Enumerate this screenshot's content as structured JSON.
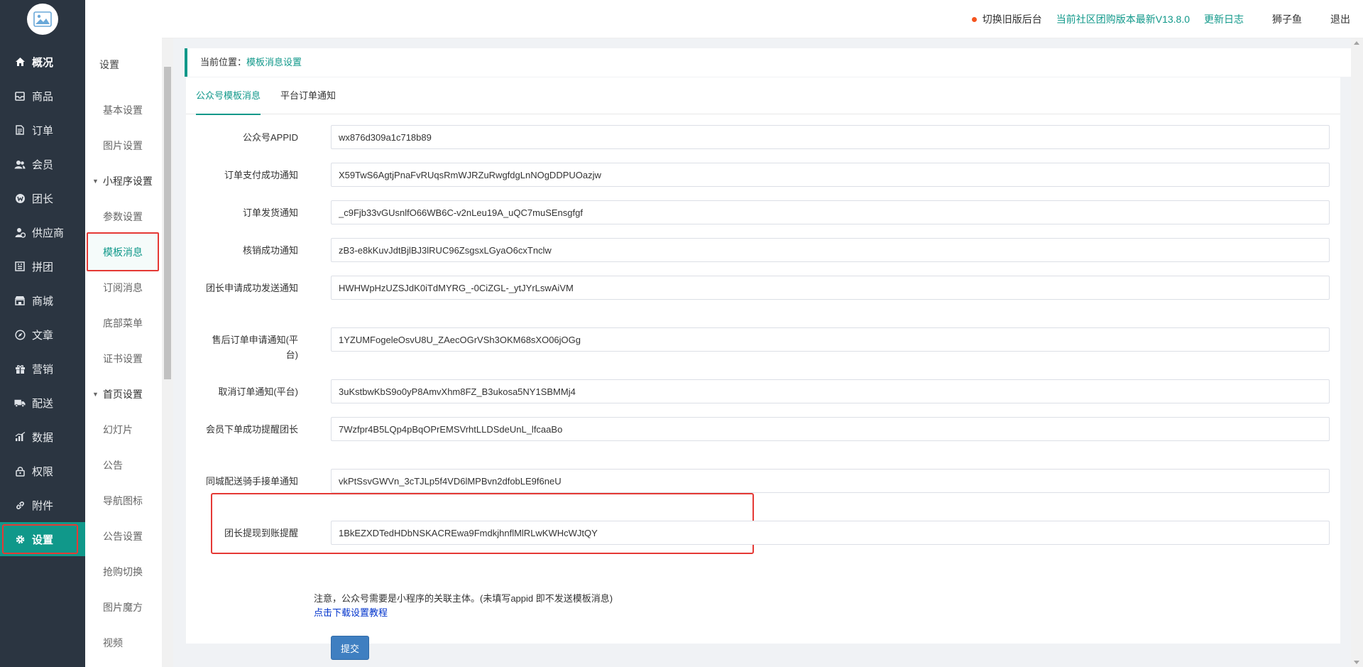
{
  "nav": {
    "items": [
      {
        "label": "概况",
        "icon": "home-icon"
      },
      {
        "label": "商品",
        "icon": "inbox-icon"
      },
      {
        "label": "订单",
        "icon": "document-icon"
      },
      {
        "label": "会员",
        "icon": "users-icon"
      },
      {
        "label": "团长",
        "icon": "leader-icon"
      },
      {
        "label": "供应商",
        "icon": "supplier-icon"
      },
      {
        "label": "拼团",
        "icon": "group-buy-icon"
      },
      {
        "label": "商城",
        "icon": "store-icon"
      },
      {
        "label": "文章",
        "icon": "compass-icon"
      },
      {
        "label": "营销",
        "icon": "gift-icon"
      },
      {
        "label": "配送",
        "icon": "truck-icon"
      },
      {
        "label": "数据",
        "icon": "chart-icon"
      },
      {
        "label": "权限",
        "icon": "lock-icon"
      },
      {
        "label": "附件",
        "icon": "link-icon"
      },
      {
        "label": "设置",
        "icon": "gear-icon"
      }
    ]
  },
  "subnav": {
    "title": "设置",
    "basic": "基本设置",
    "image": "图片设置",
    "mp_group": "小程序设置",
    "params": "参数设置",
    "template": "模板消息",
    "subscribe": "订阅消息",
    "bottom_menu": "底部菜单",
    "cert": "证书设置",
    "home_group": "首页设置",
    "slides": "幻灯片",
    "notice": "公告",
    "nav_icon": "导航图标",
    "notice_settings": "公告设置",
    "flash_switch": "抢购切换",
    "image_magic": "图片魔方",
    "video": "视频"
  },
  "header": {
    "switch_old": "切换旧版后台",
    "version": "当前社区团购版本最新V13.8.0",
    "changelog": "更新日志",
    "user": "狮子鱼",
    "logout": "退出",
    "accent": "#10988a",
    "dot_color": "#f5541e"
  },
  "breadcrumb": {
    "prefix": "当前位置：",
    "current": "模板消息设置"
  },
  "tabs": {
    "official": "公众号模板消息",
    "platform": "平台订单通知"
  },
  "form": {
    "appid_label": "公众号APPID",
    "appid_value": "wx876d309a1c718b89",
    "pay_label": "订单支付成功通知",
    "pay_value": "X59TwS6AgtjPnaFvRUqsRmWJRZuRwgfdgLnNOgDDPUOazjw",
    "ship_label": "订单发货通知",
    "ship_value": "_c9Fjb33vGUsnlfO66WB6C-v2nLeu19A_uQC7muSEnsgfgf",
    "verify_label": "核销成功通知",
    "verify_value": "zB3-e8kKuvJdtBjlBJ3lRUC96ZsgsxLGyaO6cxTnclw",
    "leader_apply_label": "团长申请成功发送通知",
    "leader_apply_value": "HWHWpHzUZSJdK0iTdMYRG_-0CiZGL-_ytJYrLswAiVM",
    "aftersale_label": "售后订单申请通知(平台)",
    "aftersale_value": "1YZUMFogeleOsvU8U_ZAecOGrVSh3OKM68sXO06jOGg",
    "cancel_label": "取消订单通知(平台)",
    "cancel_value": "3uKstbwKbS9o0yP8AmvXhm8FZ_B3ukosa5NY1SBMMj4",
    "member_order_label": "会员下单成功提醒团长",
    "member_order_value": "7Wzfpr4B5LQp4pBqOPrEMSVrhtLLDSdeUnL_lfcaaBo",
    "rider_label": "同城配送骑手接单通知",
    "rider_value": "vkPtSsvGWVn_3cTJLp5f4VD6lMPBvn2dfobLE9f6neU",
    "withdraw_label": "团长提现到账提醒",
    "withdraw_value": "1BkEZXDTedHDbNSKACREwa9FmdkjhnflMlRLwKWHcWJtQY"
  },
  "note": {
    "text": "注意，公众号需要是小程序的关联主体。(未填写appid 即不发送模板消息)",
    "link": "点击下载设置教程"
  },
  "submit_label": "提交"
}
